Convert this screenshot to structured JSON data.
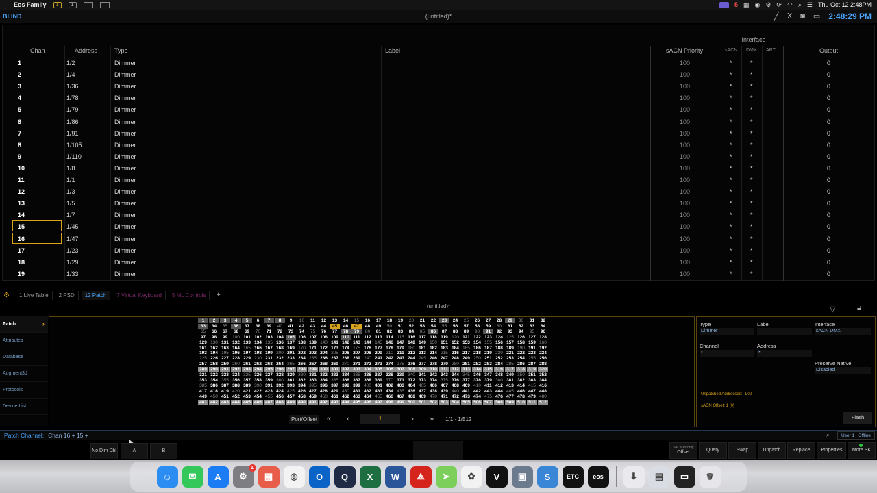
{
  "menubar": {
    "app_name": "Eos Family",
    "status_number": "5",
    "datetime": "Thu Oct 12  2:48PM"
  },
  "eosbar": {
    "mode": "BLIND",
    "layout_badge_1": "1",
    "layout_badge_2": "1",
    "title": "(untitled)*",
    "clock": "2:48:29 PM"
  },
  "patch_table": {
    "interface_header": "Interface",
    "columns": {
      "chan": "Chan",
      "address": "Address",
      "type": "Type",
      "label": "Label",
      "sacn_priority": "sACN Priority",
      "sacn": "sACN",
      "dmx": "DMX",
      "art": "ART...",
      "output": "Output"
    },
    "rows": [
      {
        "chan": "1",
        "address": "1/2",
        "type": "Dimmer",
        "priority": "100",
        "sacn": "*",
        "dmx": "*",
        "output": "0"
      },
      {
        "chan": "2",
        "address": "1/4",
        "type": "Dimmer",
        "priority": "100",
        "sacn": "*",
        "dmx": "*",
        "output": "0"
      },
      {
        "chan": "3",
        "address": "1/36",
        "type": "Dimmer",
        "priority": "100",
        "sacn": "*",
        "dmx": "*",
        "output": "0"
      },
      {
        "chan": "4",
        "address": "1/78",
        "type": "Dimmer",
        "priority": "100",
        "sacn": "*",
        "dmx": "*",
        "output": "0"
      },
      {
        "chan": "5",
        "address": "1/79",
        "type": "Dimmer",
        "priority": "100",
        "sacn": "*",
        "dmx": "*",
        "output": "0"
      },
      {
        "chan": "6",
        "address": "1/86",
        "type": "Dimmer",
        "priority": "100",
        "sacn": "*",
        "dmx": "*",
        "output": "0"
      },
      {
        "chan": "7",
        "address": "1/91",
        "type": "Dimmer",
        "priority": "100",
        "sacn": "*",
        "dmx": "*",
        "output": "0"
      },
      {
        "chan": "8",
        "address": "1/105",
        "type": "Dimmer",
        "priority": "100",
        "sacn": "*",
        "dmx": "*",
        "output": "0"
      },
      {
        "chan": "9",
        "address": "1/110",
        "type": "Dimmer",
        "priority": "100",
        "sacn": "*",
        "dmx": "*",
        "output": "0"
      },
      {
        "chan": "10",
        "address": "1/8",
        "type": "Dimmer",
        "priority": "100",
        "sacn": "*",
        "dmx": "*",
        "output": "0"
      },
      {
        "chan": "11",
        "address": "1/1",
        "type": "Dimmer",
        "priority": "100",
        "sacn": "*",
        "dmx": "*",
        "output": "0"
      },
      {
        "chan": "12",
        "address": "1/3",
        "type": "Dimmer",
        "priority": "100",
        "sacn": "*",
        "dmx": "*",
        "output": "0"
      },
      {
        "chan": "13",
        "address": "1/5",
        "type": "Dimmer",
        "priority": "100",
        "sacn": "*",
        "dmx": "*",
        "output": "0"
      },
      {
        "chan": "14",
        "address": "1/7",
        "type": "Dimmer",
        "priority": "100",
        "sacn": "*",
        "dmx": "*",
        "output": "0"
      },
      {
        "chan": "15",
        "address": "1/45",
        "type": "Dimmer",
        "priority": "100",
        "sacn": "*",
        "dmx": "*",
        "output": "0",
        "selected": true
      },
      {
        "chan": "16",
        "address": "1/47",
        "type": "Dimmer",
        "priority": "100",
        "sacn": "*",
        "dmx": "*",
        "output": "0",
        "selected": true
      },
      {
        "chan": "17",
        "address": "1/23",
        "type": "Dimmer",
        "priority": "100",
        "sacn": "*",
        "dmx": "*",
        "output": "0"
      },
      {
        "chan": "18",
        "address": "1/29",
        "type": "Dimmer",
        "priority": "100",
        "sacn": "*",
        "dmx": "*",
        "output": "0"
      },
      {
        "chan": "19",
        "address": "1/33",
        "type": "Dimmer",
        "priority": "100",
        "sacn": "*",
        "dmx": "*",
        "output": "0"
      }
    ]
  },
  "tabs": [
    {
      "label": "1 Live Table",
      "state": "normal"
    },
    {
      "label": "2 PSD",
      "state": "normal"
    },
    {
      "label": "12 Patch",
      "state": "active"
    },
    {
      "label": "7 Virtual Keyboard",
      "state": "dimmed"
    },
    {
      "label": "5 ML Controls",
      "state": "dimmed"
    }
  ],
  "tab_add": "+",
  "lower_title": "(untitled)*",
  "left_nav": [
    {
      "label": "Patch",
      "active": true
    },
    {
      "label": "Attributes"
    },
    {
      "label": "Database"
    },
    {
      "label": "Augment3d"
    },
    {
      "label": "Protocols"
    },
    {
      "label": "Device List"
    }
  ],
  "address_grid": {
    "start": 1,
    "end": 512,
    "columns": 32,
    "patched_addresses": [
      1,
      2,
      3,
      4,
      5,
      7,
      8,
      23,
      29,
      33,
      36,
      45,
      47,
      78,
      79,
      86,
      91,
      105,
      110
    ],
    "selected_addresses": [
      45,
      47
    ],
    "highlight_bands": [
      9,
      15
    ]
  },
  "pager": {
    "label": "Port/Offset",
    "value": "1",
    "range": "1/1 - 1/512"
  },
  "properties": {
    "type_label": "Type",
    "type_value": "Dimmer",
    "label_label": "Label",
    "label_value": "",
    "interface_label": "Interface",
    "interface_value": "sACN DMX",
    "channel_label": "Channel",
    "channel_value": "*",
    "address_label": "Address",
    "address_value": "*",
    "preserve_native_label": "Preserve Native",
    "preserve_native_value": "Disabled",
    "unpatched_note": "Unpatched Addresses: -102",
    "sacn_offset_note": "sACN Offset: 1 (0)",
    "flash_label": "Flash"
  },
  "command_line": {
    "label": "Patch Channel:",
    "text": "Chan 16 + 15 +",
    "user": "User 1 | Offline"
  },
  "softkeys": {
    "no_dim_dbl": "No Dim Dbl",
    "a": "A",
    "b": "B",
    "offset_sup": "sACN Priority",
    "offset": "Offset",
    "query": "Query",
    "swap": "Swap",
    "unpatch": "Unpatch",
    "replace": "Replace",
    "properties": "Properties",
    "more_sk": "More SK"
  },
  "dock": {
    "calendar_badge": "1",
    "apps": [
      "finder-icon",
      "messages-icon",
      "app-store-icon",
      "system-settings-icon",
      "launchpad-icon",
      "chrome-icon",
      "outlook-icon",
      "quicktime-icon",
      "excel-icon",
      "word-icon",
      "acrobat-icon",
      "maps-icon",
      "photos-icon",
      "vectorworks-icon",
      "preview-icon",
      "notes-icon",
      "etc-icon",
      "eos-icon",
      "downloads-icon",
      "folder-icon",
      "screens-icon",
      "trash-icon"
    ]
  },
  "colors": {
    "accent_blue": "#4aa6ff",
    "accent_gold": "#d9a41a",
    "background": "#000000"
  }
}
